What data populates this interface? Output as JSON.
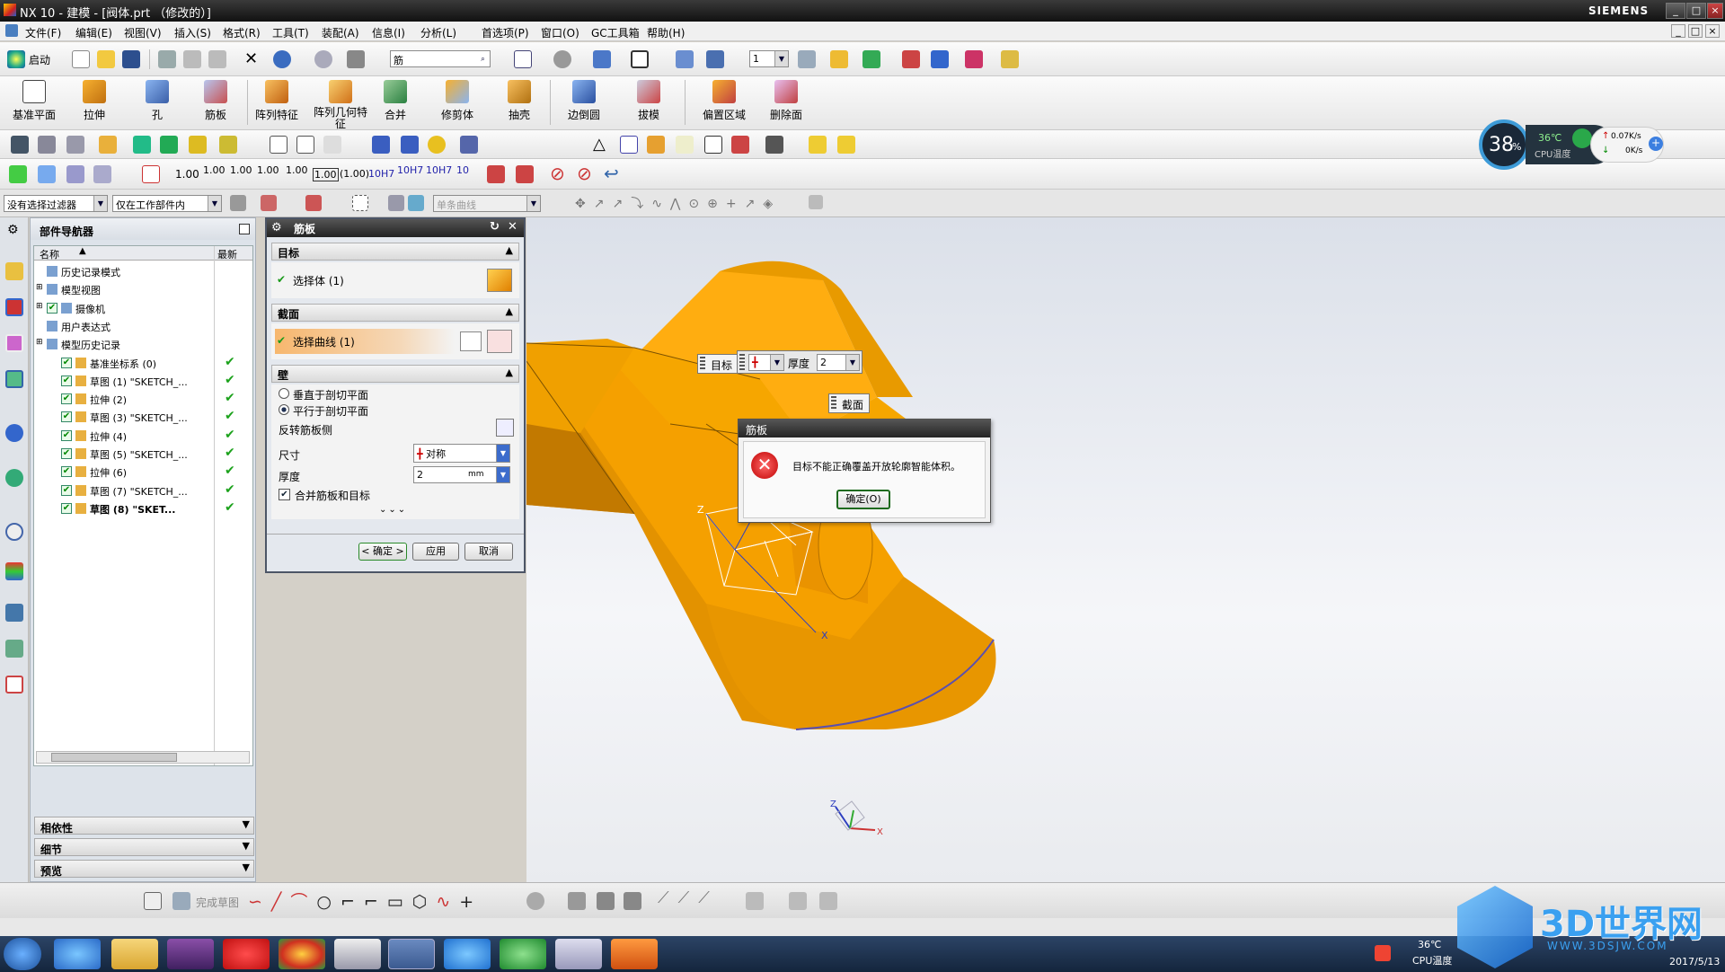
{
  "window": {
    "title": "NX 10 - 建模 - [阀体.prt （修改的）]",
    "brand": "SIEMENS"
  },
  "menu": [
    "文件(F)",
    "编辑(E)",
    "视图(V)",
    "插入(S)",
    "格式(R)",
    "工具(T)",
    "装配(A)",
    "信息(I)",
    "分析(L)",
    "首选项(P)",
    "窗口(O)",
    "GC工具箱",
    "帮助(H)"
  ],
  "toolbar1": {
    "start_label": "启动",
    "search_value": "筋",
    "layer_value": "1"
  },
  "ribbon": [
    "基准平面",
    "拉伸",
    "孔",
    "筋板",
    "阵列特征",
    "阵列几何特征",
    "合并",
    "修剪体",
    "抽壳",
    "边倒圆",
    "拔模",
    "偏置区域",
    "删除面"
  ],
  "pmi": {
    "labels": [
      "1.00",
      "1.00",
      "1.00",
      "1.00",
      "1.00",
      "1.00",
      "(1.00)",
      "10H7",
      "10H7",
      "10H7",
      "10"
    ]
  },
  "filterbar": {
    "type_filter": "没有选择过滤器",
    "scope_filter": "仅在工作部件内",
    "curve_rule": "单条曲线"
  },
  "cpu": {
    "percent": "38",
    "unit": "%",
    "temp": "36℃",
    "temp_label": "CPU温度",
    "up": "0.07K/s",
    "down": "0K/s"
  },
  "navigator": {
    "title": "部件导航器",
    "col_name": "名称",
    "col_latest": "最新",
    "rows": [
      {
        "label": "历史记录模式",
        "check": false,
        "ok": false,
        "indent": 1
      },
      {
        "label": "模型视图",
        "check": false,
        "ok": false,
        "indent": 0
      },
      {
        "label": "摄像机",
        "check": true,
        "ok": false,
        "indent": 0
      },
      {
        "label": "用户表达式",
        "check": false,
        "ok": false,
        "indent": 1
      },
      {
        "label": "模型历史记录",
        "check": false,
        "ok": false,
        "indent": 0
      },
      {
        "label": "基准坐标系 (0)",
        "check": true,
        "ok": true,
        "indent": 2
      },
      {
        "label": "草图 (1) \"SKETCH_...",
        "check": true,
        "ok": true,
        "indent": 2
      },
      {
        "label": "拉伸 (2)",
        "check": true,
        "ok": true,
        "indent": 2
      },
      {
        "label": "草图 (3) \"SKETCH_...",
        "check": true,
        "ok": true,
        "indent": 2
      },
      {
        "label": "拉伸 (4)",
        "check": true,
        "ok": true,
        "indent": 2
      },
      {
        "label": "草图 (5) \"SKETCH_...",
        "check": true,
        "ok": true,
        "indent": 2
      },
      {
        "label": "拉伸 (6)",
        "check": true,
        "ok": true,
        "indent": 2
      },
      {
        "label": "草图 (7) \"SKETCH_...",
        "check": true,
        "ok": true,
        "indent": 2
      },
      {
        "label": "草图 (8) \"SKET...",
        "check": true,
        "ok": true,
        "indent": 2
      }
    ],
    "sections": [
      "相依性",
      "细节",
      "预览"
    ]
  },
  "rib_dialog": {
    "title": "筋板",
    "target_header": "目标",
    "target_select": "选择体 (1)",
    "section_header": "截面",
    "section_select": "选择曲线 (1)",
    "wall_header": "壁",
    "radio1": "垂直于剖切平面",
    "radio2": "平行于剖切平面",
    "reverse_label": "反转筋板侧",
    "size_label": "尺寸",
    "size_value": "对称",
    "thickness_label": "厚度",
    "thickness_value": "2",
    "thickness_unit": "mm",
    "combine_label": "合并筋板和目标",
    "ok": "< 确定 >",
    "apply": "应用",
    "cancel": "取消"
  },
  "onscreen": {
    "target_tag": "目标",
    "thickness_label": "厚度",
    "thickness_value": "2",
    "section_tag": "截面"
  },
  "error_dialog": {
    "title": "筋板",
    "message": "目标不能正确覆盖开放轮廓智能体积。",
    "ok": "确定(O)"
  },
  "axes": {
    "x": "X",
    "y": "Y",
    "z": "Z"
  },
  "bottombar": {
    "finish_sketch": "完成草图"
  },
  "tray": {
    "temp": "36℃",
    "temp_label": "CPU温度",
    "date": "2017/5/13"
  },
  "watermark": {
    "brand": "3D世界网",
    "url": "WWW.3DSJW.COM"
  },
  "colors": {
    "part": "#f5a000",
    "part_dark": "#d98400",
    "part_light": "#ffbd2e",
    "dialog_header": "#333333"
  }
}
